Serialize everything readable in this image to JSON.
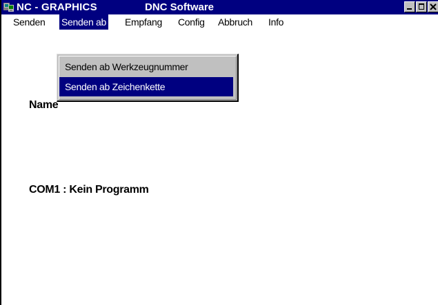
{
  "window": {
    "title": "NC - GRAPHICS",
    "title_right": "DNC Software",
    "icon": "app-icon"
  },
  "menubar": {
    "items": [
      {
        "label": "Senden"
      },
      {
        "label": "Senden ab"
      },
      {
        "label": "Empfang"
      },
      {
        "label": "Config"
      },
      {
        "label": "Abbruch"
      },
      {
        "label": "Info"
      }
    ],
    "active_index": 1
  },
  "dropdown": {
    "items": [
      {
        "label": "Senden ab Werkzeugnummer"
      },
      {
        "label": "Senden ab Zeichenkette"
      }
    ],
    "highlighted_index": 1
  },
  "main": {
    "name_label": "Name",
    "status": "COM1 : Kein Programm"
  },
  "colors": {
    "titlebar": "#000080",
    "highlight": "#000080",
    "menu_bg": "#c0c0c0"
  }
}
